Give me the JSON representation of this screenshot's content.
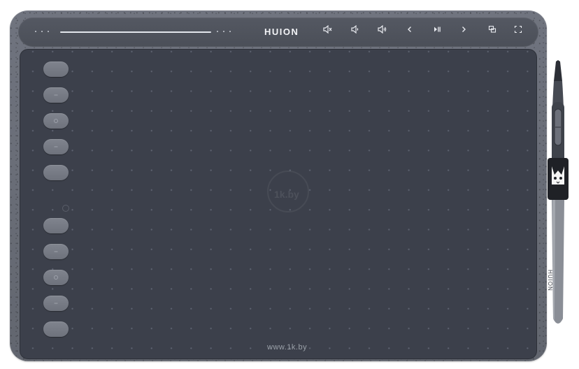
{
  "device": {
    "brand": "HUION",
    "pen_brand": "HUION",
    "colors": {
      "body": "#666a74",
      "active_area": "#3c404b",
      "keys": "#767a84",
      "top_strip": "#50545d"
    }
  },
  "top_controls": [
    {
      "name": "mute-icon",
      "glyph": "◁×"
    },
    {
      "name": "volume-down-icon",
      "glyph": "◁"
    },
    {
      "name": "volume-up-icon",
      "glyph": "◁)"
    },
    {
      "name": "previous-icon",
      "glyph": "‹"
    },
    {
      "name": "play-pause-icon",
      "glyph": "▶‖"
    },
    {
      "name": "next-icon",
      "glyph": "›"
    },
    {
      "name": "switch-screen-icon",
      "glyph": "⧉"
    },
    {
      "name": "fullscreen-icon",
      "glyph": "⛶"
    }
  ],
  "side_keys": [
    {
      "mark": "none"
    },
    {
      "mark": "dash"
    },
    {
      "mark": "dot"
    },
    {
      "mark": "dash"
    },
    {
      "mark": "none"
    },
    {
      "mark": "none"
    },
    {
      "mark": "dash"
    },
    {
      "mark": "dot"
    },
    {
      "mark": "dash"
    },
    {
      "mark": "none"
    }
  ],
  "watermarks": {
    "center": "1k.by",
    "bottom": "www.1k.by"
  }
}
